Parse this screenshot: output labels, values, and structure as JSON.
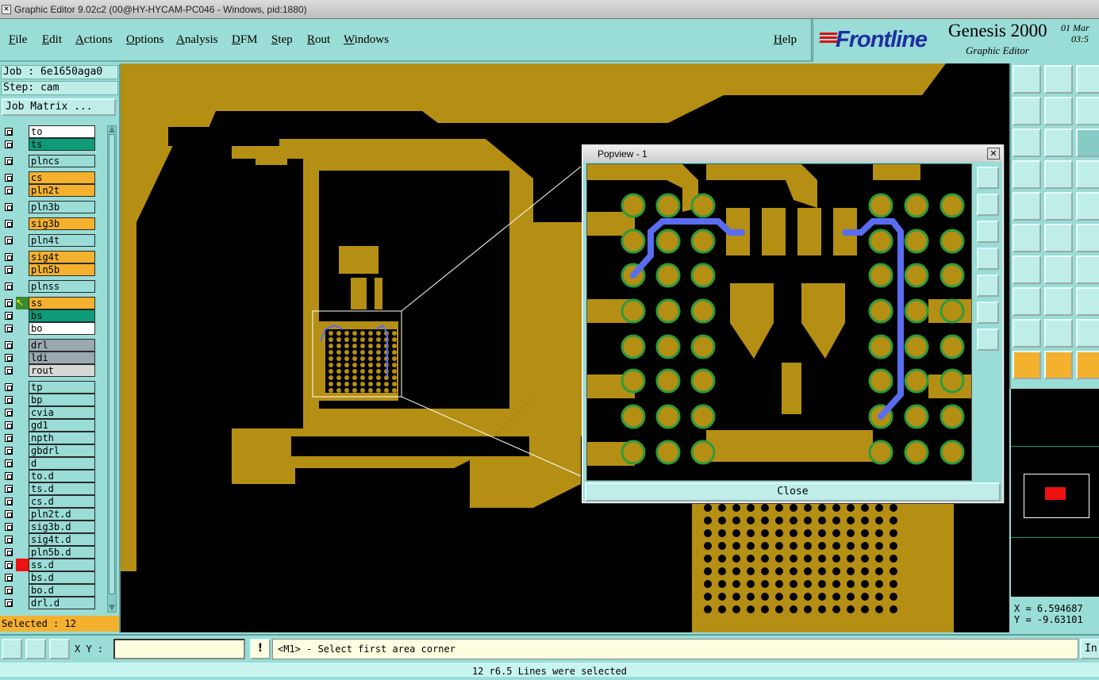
{
  "window": {
    "title": "Graphic Editor 9.02c2 (00@HY-HYCAM-PC046 - Windows, pid:1880)"
  },
  "menu": {
    "items": [
      "File",
      "Edit",
      "Actions",
      "Options",
      "Analysis",
      "DFM",
      "Step",
      "Rout",
      "Windows"
    ],
    "help": "Help"
  },
  "brand": {
    "logo": "Frontline",
    "product": "Genesis 2000",
    "subtitle": "Graphic Editor",
    "date": "01 Mar",
    "time": "03:5"
  },
  "job": {
    "job_line": "Job : 6e1650aga0",
    "step_line": "Step: cam",
    "matrix_button": "Job Matrix ..."
  },
  "layers": [
    {
      "name": "to",
      "color": "#ffffff"
    },
    {
      "name": "ts",
      "color": "#0e9b78"
    },
    {
      "name": "plncs",
      "color": "#9adcd6"
    },
    {
      "name": "cs",
      "color": "#f3b12e"
    },
    {
      "name": "pln2t",
      "color": "#f3b12e"
    },
    {
      "name": "pln3b",
      "color": "#9adcd6"
    },
    {
      "name": "sig3b",
      "color": "#f3b12e"
    },
    {
      "name": "pln4t",
      "color": "#9adcd6"
    },
    {
      "name": "sig4t",
      "color": "#f3b12e"
    },
    {
      "name": "pln5b",
      "color": "#f3b12e"
    },
    {
      "name": "plnss",
      "color": "#9adcd6"
    },
    {
      "name": "ss",
      "color": "#f3b12e"
    },
    {
      "name": "bs",
      "color": "#0e9b78"
    },
    {
      "name": "bo",
      "color": "#ffffff"
    },
    {
      "name": "drl",
      "color": "#9aa9b0"
    },
    {
      "name": "ldi",
      "color": "#9aa9b0"
    },
    {
      "name": "rout",
      "color": "#d8d8d8"
    },
    {
      "name": "tp",
      "color": "#9adcd6"
    },
    {
      "name": "bp",
      "color": "#9adcd6"
    },
    {
      "name": "cvia",
      "color": "#9adcd6"
    },
    {
      "name": "gd1",
      "color": "#9adcd6"
    },
    {
      "name": "npth",
      "color": "#9adcd6"
    },
    {
      "name": "gbdrl",
      "color": "#9adcd6"
    },
    {
      "name": "d",
      "color": "#9adcd6"
    },
    {
      "name": "to.d",
      "color": "#9adcd6"
    },
    {
      "name": "ts.d",
      "color": "#9adcd6"
    },
    {
      "name": "cs.d",
      "color": "#9adcd6"
    },
    {
      "name": "pln2t.d",
      "color": "#9adcd6"
    },
    {
      "name": "sig3b.d",
      "color": "#9adcd6"
    },
    {
      "name": "sig4t.d",
      "color": "#9adcd6"
    },
    {
      "name": "pln5b.d",
      "color": "#9adcd6"
    },
    {
      "name": "ss.d",
      "color": "#9adcd6"
    },
    {
      "name": "bs.d",
      "color": "#9adcd6"
    },
    {
      "name": "bo.d",
      "color": "#9adcd6"
    },
    {
      "name": "drl.d",
      "color": "#9adcd6"
    }
  ],
  "selected_text": "Selected : 12",
  "popview": {
    "title": "Popview - 1",
    "close_label": "Close"
  },
  "coords": {
    "x": "X = 6.594687",
    "y": "Y = -9.63101"
  },
  "status": {
    "xy_label": "X Y :",
    "xy_value": "",
    "prompt": "<M1> - Select first area corner",
    "in_label": "In",
    "message": "12 r6.5 Lines were selected"
  },
  "colors": {
    "copper": "#b48f14",
    "background": "#000000",
    "panel": "#9adcd6",
    "selection": "#5a6cf0",
    "pad_ring": "#2e9a3c"
  }
}
